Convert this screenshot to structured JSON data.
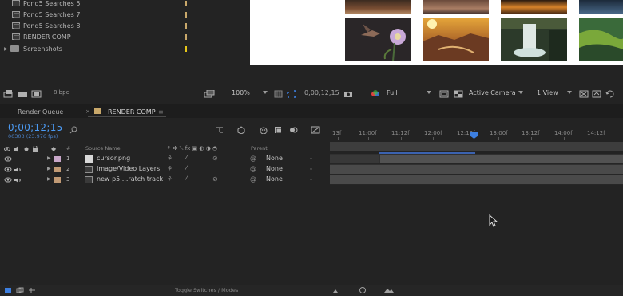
{
  "project": {
    "items": [
      {
        "name": "Pond5 Searches 5",
        "type": "comp",
        "label_color": "#c9a86a"
      },
      {
        "name": "Pond5 Searches 7",
        "type": "comp",
        "label_color": "#c9a86a"
      },
      {
        "name": "Pond5 Searches 8",
        "type": "comp",
        "label_color": "#c9a86a"
      },
      {
        "name": "RENDER COMP",
        "type": "comp",
        "label_color": "#c9a86a"
      },
      {
        "name": "Screenshots",
        "type": "folder",
        "label_color": "#e6c619"
      }
    ],
    "bit_depth": "8 bpc"
  },
  "viewer_toolbar": {
    "zoom": "100%",
    "timecode": "0;00;12;15",
    "resolution": "Full",
    "camera": "Active Camera",
    "view_layout": "1 View"
  },
  "panel_tabs": {
    "render_queue": "Render Queue",
    "render_comp": "RENDER COMP"
  },
  "timeline": {
    "current_time": "0;00;12;15",
    "frame_info": "00303 (23.976 fps)",
    "columns": {
      "number": "#",
      "source_name": "Source Name",
      "parent": "Parent"
    },
    "ruler_labels": [
      "13f",
      "11:00f",
      "11:12f",
      "12:00f",
      "12:12f",
      "13:00f",
      "13:12f",
      "14:00f",
      "14:12f"
    ],
    "layers": [
      {
        "index": "1",
        "name": "cursor.png",
        "parent": "None",
        "label_color": "#c8a7c9",
        "has_audio": false
      },
      {
        "index": "2",
        "name": "Image/Video Layers",
        "parent": "None",
        "label_color": "#c19a75",
        "has_audio": true
      },
      {
        "index": "3",
        "name": "new p5 ...ratch track",
        "parent": "None",
        "label_color": "#c19a75",
        "has_audio": true
      }
    ],
    "toggle_label": "Toggle Switches / Modes"
  },
  "colors": {
    "accent": "#3d7fe0",
    "time_text": "#4b9bf5",
    "panel_bg": "#232323"
  }
}
